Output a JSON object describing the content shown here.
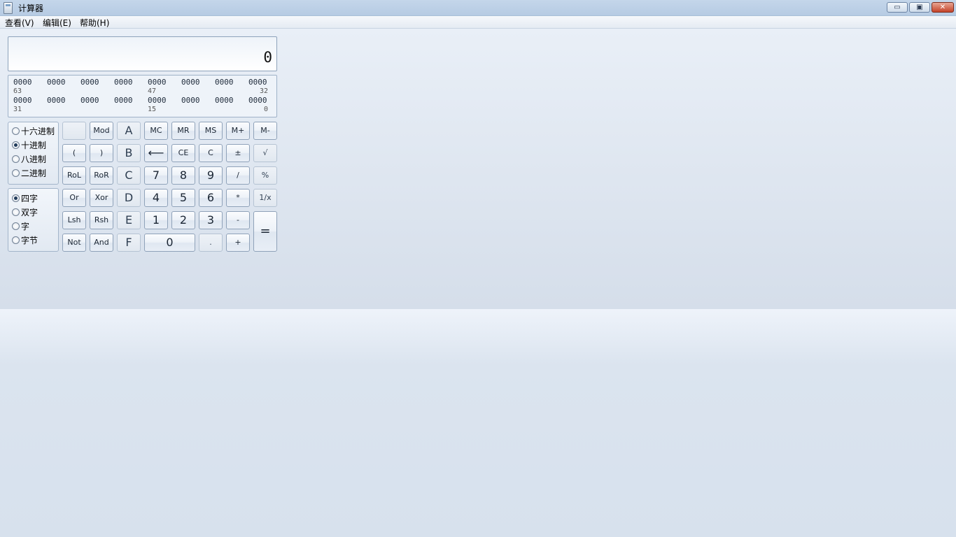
{
  "window": {
    "title": "计算器",
    "minimize": "▭",
    "restore": "▣",
    "close": "✕"
  },
  "menu": [
    "查看(V)",
    "编辑(E)",
    "帮助(H)"
  ],
  "display": {
    "value": "0"
  },
  "bits": {
    "row1": [
      "0000",
      "0000",
      "0000",
      "0000",
      "0000",
      "0000",
      "0000",
      "0000"
    ],
    "row2": [
      "0000",
      "0000",
      "0000",
      "0000",
      "0000",
      "0000",
      "0000",
      "0000"
    ],
    "idx1": {
      "a": "63",
      "b": "47",
      "c": "32"
    },
    "idx2": {
      "a": "31",
      "b": "15",
      "c": "0"
    }
  },
  "base": [
    {
      "label": "十六进制",
      "checked": false
    },
    {
      "label": "十进制",
      "checked": true
    },
    {
      "label": "八进制",
      "checked": false
    },
    {
      "label": "二进制",
      "checked": false
    }
  ],
  "word": [
    {
      "label": "四字",
      "checked": true
    },
    {
      "label": "双字",
      "checked": false
    },
    {
      "label": "字",
      "checked": false
    },
    {
      "label": "字节",
      "checked": false
    }
  ],
  "keys": {
    "r1": [
      "",
      "Mod",
      "A",
      "MC",
      "MR",
      "MS",
      "M+",
      "M-"
    ],
    "r2": [
      "(",
      ")",
      "B",
      "⟵",
      "CE",
      "C",
      "±",
      "√"
    ],
    "r3": [
      "RoL",
      "RoR",
      "C",
      "7",
      "8",
      "9",
      "/",
      "%"
    ],
    "r4": [
      "Or",
      "Xor",
      "D",
      "4",
      "5",
      "6",
      "*",
      "1/x"
    ],
    "r5": [
      "Lsh",
      "Rsh",
      "E",
      "1",
      "2",
      "3",
      "-"
    ],
    "r6": [
      "Not",
      "And",
      "F",
      "0",
      ".",
      "+"
    ],
    "equals": "="
  }
}
